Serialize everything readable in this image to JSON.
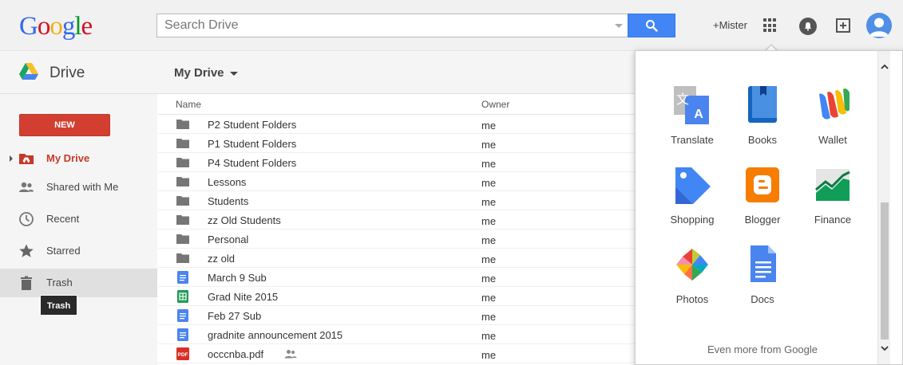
{
  "header": {
    "logo_letters": [
      {
        "ch": "G",
        "color": "#3369e8"
      },
      {
        "ch": "o",
        "color": "#d50f25"
      },
      {
        "ch": "o",
        "color": "#eeb211"
      },
      {
        "ch": "g",
        "color": "#3369e8"
      },
      {
        "ch": "l",
        "color": "#009925"
      },
      {
        "ch": "e",
        "color": "#d50f25"
      }
    ],
    "search_placeholder": "Search Drive",
    "user_link": "+Mister"
  },
  "subheader": {
    "product": "Drive",
    "location": "My Drive"
  },
  "sidebar": {
    "new_label": "NEW",
    "items": [
      {
        "label": "My Drive",
        "icon": "my-drive-icon"
      },
      {
        "label": "Shared with Me",
        "icon": "people-icon"
      },
      {
        "label": "Recent",
        "icon": "clock-icon"
      },
      {
        "label": "Starred",
        "icon": "star-icon"
      },
      {
        "label": "Trash",
        "icon": "trash-icon"
      }
    ],
    "tooltip": "Trash"
  },
  "file_list": {
    "columns": {
      "name": "Name",
      "owner": "Owner"
    },
    "rows": [
      {
        "name": "P2 Student Folders",
        "owner": "me",
        "type": "folder"
      },
      {
        "name": "P1 Student Folders",
        "owner": "me",
        "type": "folder"
      },
      {
        "name": "P4 Student Folders",
        "owner": "me",
        "type": "folder"
      },
      {
        "name": "Lessons",
        "owner": "me",
        "type": "folder"
      },
      {
        "name": "Students",
        "owner": "me",
        "type": "folder"
      },
      {
        "name": "zz Old Students",
        "owner": "me",
        "type": "folder"
      },
      {
        "name": "Personal",
        "owner": "me",
        "type": "folder"
      },
      {
        "name": "zz old",
        "owner": "me",
        "type": "folder"
      },
      {
        "name": "March 9 Sub",
        "owner": "me",
        "type": "doc"
      },
      {
        "name": "Grad Nite 2015",
        "owner": "me",
        "type": "sheet"
      },
      {
        "name": "Feb 27 Sub",
        "owner": "me",
        "type": "doc"
      },
      {
        "name": "gradnite announcement 2015",
        "owner": "me",
        "type": "doc"
      },
      {
        "name": "occcnba.pdf",
        "owner": "me",
        "type": "pdf",
        "shared": true
      }
    ]
  },
  "apps_panel": {
    "apps": [
      {
        "label": "Translate",
        "icon": "translate-icon"
      },
      {
        "label": "Books",
        "icon": "books-icon"
      },
      {
        "label": "Wallet",
        "icon": "wallet-icon"
      },
      {
        "label": "Shopping",
        "icon": "shopping-icon"
      },
      {
        "label": "Blogger",
        "icon": "blogger-icon"
      },
      {
        "label": "Finance",
        "icon": "finance-icon"
      },
      {
        "label": "Photos",
        "icon": "photos-icon"
      },
      {
        "label": "Docs",
        "icon": "docs-icon"
      }
    ],
    "more_link": "Even more from Google"
  },
  "colors": {
    "accent_blue": "#4285f4",
    "new_red": "#d23f31",
    "active_red": "#c53929"
  },
  "pdf_badge": "PDF"
}
